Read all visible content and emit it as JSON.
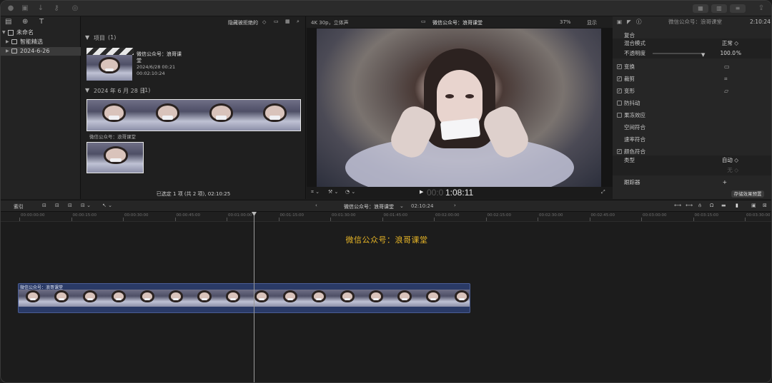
{
  "libraries": {
    "root": "未命名",
    "items": [
      {
        "label": "智能精选"
      },
      {
        "label": "2024-6-26"
      }
    ]
  },
  "browser": {
    "filter": "隐藏被拒绝的",
    "projects_header": "项目",
    "projects_count": "(1)",
    "project": {
      "name_line1": "微信公众号：浪哥课",
      "name_line2": "堂",
      "date": "2024/6/28 00:21",
      "duration": "00:02:10:24"
    },
    "event_header": "2024 年 6 月 28 日",
    "event_count": "(1)",
    "clip_name": "微信公众号：浪哥课堂",
    "status": "已选定 1 项 (共 2 项), 02:10:25"
  },
  "viewer": {
    "format": "4K 30p，立体声",
    "title": "微信公众号：浪哥课堂",
    "zoom": "37%",
    "display": "显示",
    "timecode_prefix": "00:0",
    "timecode": "1:08:11"
  },
  "inspector": {
    "title": "微信公众号：浪哥课堂",
    "duration": "2:10:24",
    "rows": {
      "composite": "复合",
      "blend_mode": "混合模式",
      "blend_value": "正常 ◇",
      "opacity": "不透明度",
      "opacity_value": "100.0",
      "opacity_unit": "%",
      "transform": "变换",
      "crop": "裁剪",
      "distort": "变形",
      "stabilize": "防抖动",
      "rolling_shutter": "果冻效应",
      "spatial_conform": "空间符合",
      "rate_conform": "速率符合",
      "color_conform": "颜色符合",
      "type": "类型",
      "type_value": "自动 ◇",
      "tracker": "跟踪器",
      "tracker_plus": "+",
      "save_preset": "存储效果预置",
      "hidden_row_value": "无 ◇"
    }
  },
  "timeline": {
    "index_label": "索引",
    "project_title": "微信公众号：浪哥课堂",
    "project_duration": "02:10:24",
    "ruler_ticks": [
      "00:00:00:00",
      "00:00:15:00",
      "00:00:30:00",
      "00:00:45:00",
      "00:01:00:00",
      "00:01:15:00",
      "00:01:30:00",
      "00:01:45:00",
      "00:02:00:00",
      "00:02:15:00",
      "00:02:30:00",
      "00:02:45:00",
      "00:03:00:00",
      "00:03:15:00",
      "00:03:30:00"
    ],
    "title_clip": "微信公众号：浪哥课堂",
    "video_clip_label": "微信公众号：浪哥课堂"
  }
}
